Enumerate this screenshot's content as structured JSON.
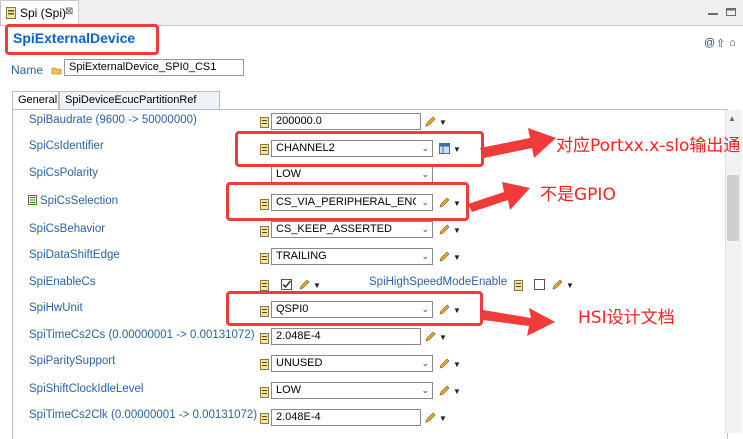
{
  "editor_tab": {
    "label": "Spi (Spi)",
    "close": "⊠"
  },
  "header": {
    "title": "SpiExternalDevice",
    "icons": [
      "help-icon",
      "up-icon",
      "home-icon"
    ]
  },
  "name_field": {
    "label": "Name",
    "value": "SpiExternalDevice_SPI0_CS1"
  },
  "subtabs": [
    {
      "label": "General"
    },
    {
      "label": "SpiDeviceEcucPartitionRef"
    }
  ],
  "rows": {
    "baudrate": {
      "label": "SpiBaudrate (9600 -> 50000000)",
      "value": "200000.0"
    },
    "cs_identifier": {
      "label": "SpiCsIdentifier",
      "value": "CHANNEL2"
    },
    "cs_polarity": {
      "label": "SpiCsPolarity",
      "value": "LOW"
    },
    "cs_selection": {
      "label": "SpiCsSelection",
      "value": "CS_VIA_PERIPHERAL_ENGINE"
    },
    "cs_behavior": {
      "label": "SpiCsBehavior",
      "value": "CS_KEEP_ASSERTED"
    },
    "data_shift_edge": {
      "label": "SpiDataShiftEdge",
      "value": "TRAILING"
    },
    "enable_cs": {
      "label": "SpiEnableCs",
      "checked": true
    },
    "high_speed": {
      "label": "SpiHighSpeedModeEnable",
      "checked": false
    },
    "hw_unit": {
      "label": "SpiHwUnit",
      "value": "QSPI0"
    },
    "time_cs2cs": {
      "label": "SpiTimeCs2Cs (0.00000001 -> 0.00131072)",
      "value": "2.048E-4"
    },
    "parity_support": {
      "label": "SpiParitySupport",
      "value": "UNUSED"
    },
    "shift_clock_idle": {
      "label": "SpiShiftClockIdleLevel",
      "value": "LOW"
    },
    "time_cs2clk": {
      "label": "SpiTimeCs2Clk (0.00000001 -> 0.00131072)",
      "value": "2.048E-4"
    }
  },
  "annotations": {
    "note1": "对应Portxx.x-slo输出通",
    "note2": "不是GPIO",
    "note3": "HSI设计文档"
  },
  "colors": {
    "annotation": "#f03b3b",
    "label_blue": "#2a63a6",
    "title_blue": "#0a63c9"
  }
}
